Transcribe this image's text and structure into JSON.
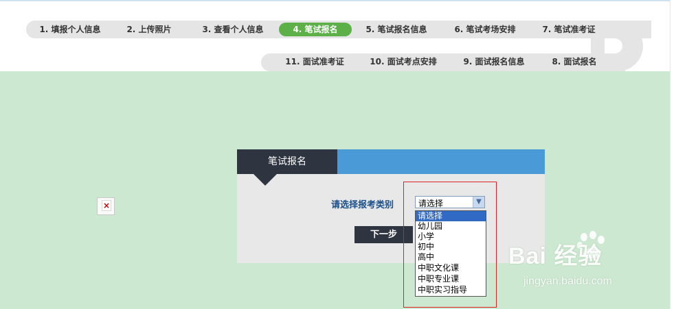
{
  "steps_row1": [
    {
      "label": "1. 填报个人信息",
      "active": false
    },
    {
      "label": "2. 上传照片",
      "active": false
    },
    {
      "label": "3. 查看个人信息",
      "active": false
    },
    {
      "label": "4. 笔试报名",
      "active": true
    },
    {
      "label": "5. 笔试报名信息",
      "active": false
    },
    {
      "label": "6. 笔试考场安排",
      "active": false
    },
    {
      "label": "7. 笔试准考证",
      "active": false
    }
  ],
  "steps_row2": [
    {
      "label": "11. 面试准考证"
    },
    {
      "label": "10. 面试考点安排"
    },
    {
      "label": "9. 面试报名信息"
    },
    {
      "label": "8. 面试报名"
    }
  ],
  "panel": {
    "title": "笔试报名",
    "select_label": "请选择报考类别",
    "select_value": "请选择",
    "next_button": "下一步"
  },
  "dropdown_options": [
    "请选择",
    "幼儿园",
    "小学",
    "初中",
    "高中",
    "中职文化课",
    "中职专业课",
    "中职实习指导"
  ],
  "broken_image_glyph": "×",
  "watermark": {
    "logo": "Bai 经验",
    "url": "jingyan.baidu.com"
  },
  "colors": {
    "active_step": "#5cb047",
    "content_bg": "#cde8d0",
    "panel_tab": "#2f3441",
    "panel_head": "#4a9ad8",
    "highlight": "#e02020"
  }
}
